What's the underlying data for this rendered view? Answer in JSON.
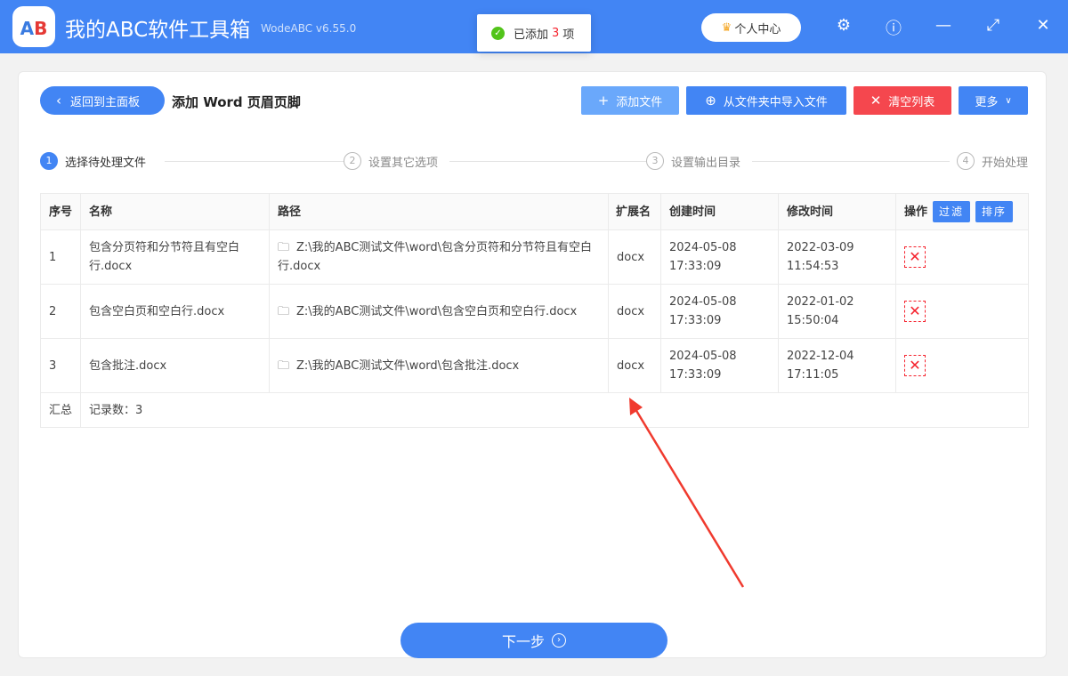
{
  "app": {
    "logo_text": "AB",
    "title": "我的ABC软件工具箱",
    "version": "WodeABC v6.55.0"
  },
  "toast": {
    "prefix": "已添加",
    "count": "3",
    "suffix": "项"
  },
  "user_center": "个人中心",
  "header": {
    "back_label": "返回到主面板",
    "page_title": "添加 Word 页眉页脚",
    "add_file": "添加文件",
    "import_folder": "从文件夹中导入文件",
    "clear_list": "清空列表",
    "more": "更多"
  },
  "steps": [
    {
      "num": "1",
      "label": "选择待处理文件"
    },
    {
      "num": "2",
      "label": "设置其它选项"
    },
    {
      "num": "3",
      "label": "设置输出目录"
    },
    {
      "num": "4",
      "label": "开始处理"
    }
  ],
  "table": {
    "headers": {
      "index": "序号",
      "name": "名称",
      "path": "路径",
      "ext": "扩展名",
      "created": "创建时间",
      "modified": "修改时间",
      "action": "操作",
      "filter": "过滤",
      "sort": "排序"
    },
    "rows": [
      {
        "index": "1",
        "name": "包含分页符和分节符且有空白行.docx",
        "path": "Z:\\我的ABC测试文件\\word\\包含分页符和分节符且有空白行.docx",
        "ext": "docx",
        "created": "2024-05-08 17:33:09",
        "modified": "2022-03-09 11:54:53"
      },
      {
        "index": "2",
        "name": "包含空白页和空白行.docx",
        "path": "Z:\\我的ABC测试文件\\word\\包含空白页和空白行.docx",
        "ext": "docx",
        "created": "2024-05-08 17:33:09",
        "modified": "2022-01-02 15:50:04"
      },
      {
        "index": "3",
        "name": "包含批注.docx",
        "path": "Z:\\我的ABC测试文件\\word\\包含批注.docx",
        "ext": "docx",
        "created": "2024-05-08 17:33:09",
        "modified": "2022-12-04 17:11:05"
      }
    ],
    "summary_label": "汇总",
    "summary_value": "记录数：3"
  },
  "next_label": "下一步",
  "colors": {
    "primary": "#4285f4",
    "danger": "#f5474e",
    "light_primary": "#6aa8fb"
  }
}
